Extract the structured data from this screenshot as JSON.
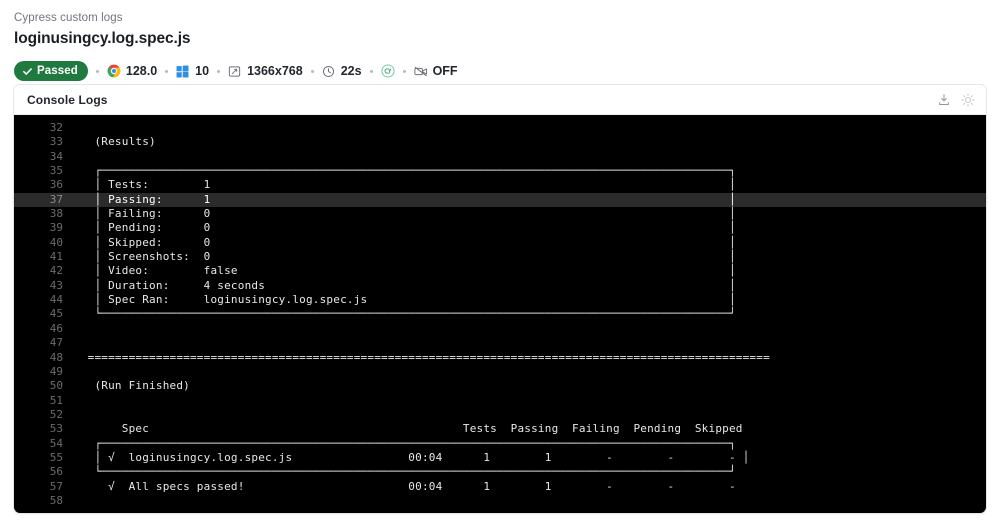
{
  "header": {
    "breadcrumb": "Cypress custom logs",
    "spec_title": "loginusingcy.log.spec.js"
  },
  "status": {
    "badge_label": "Passed",
    "badge_color": "#1f7a3f",
    "items": [
      {
        "icon": "chrome-icon",
        "label": "128.0"
      },
      {
        "icon": "windows-icon",
        "label": "10"
      },
      {
        "icon": "viewport-icon",
        "label": "1366x768"
      },
      {
        "icon": "clock-icon",
        "label": "22s"
      },
      {
        "icon": "cypress-icon",
        "label": ""
      },
      {
        "icon": "video-off-icon",
        "label": "OFF"
      }
    ]
  },
  "console_panel": {
    "title": "Console Logs",
    "actions": [
      {
        "name": "download-icon",
        "tooltip": "Download"
      },
      {
        "name": "theme-toggle-icon",
        "tooltip": "Toggle theme"
      }
    ],
    "highlighted_line": 37,
    "lines": [
      {
        "n": 32,
        "t": ""
      },
      {
        "n": 33,
        "t": "   (Results)"
      },
      {
        "n": 34,
        "t": ""
      },
      {
        "n": 35,
        "t": "   ┌────────────────────────────────────────────────────────────────────────────────────────────┐"
      },
      {
        "n": 36,
        "t": "   │ Tests:        1                                                                            │"
      },
      {
        "n": 37,
        "t": "   │ Passing:      1                                                                            │"
      },
      {
        "n": 38,
        "t": "   │ Failing:      0                                                                            │"
      },
      {
        "n": 39,
        "t": "   │ Pending:      0                                                                            │"
      },
      {
        "n": 40,
        "t": "   │ Skipped:      0                                                                            │"
      },
      {
        "n": 41,
        "t": "   │ Screenshots:  0                                                                            │"
      },
      {
        "n": 42,
        "t": "   │ Video:        false                                                                        │"
      },
      {
        "n": 43,
        "t": "   │ Duration:     4 seconds                                                                    │"
      },
      {
        "n": 44,
        "t": "   │ Spec Ran:     loginusingcy.log.spec.js                                                     │"
      },
      {
        "n": 45,
        "t": "   └────────────────────────────────────────────────────────────────────────────────────────────┘"
      },
      {
        "n": 46,
        "t": ""
      },
      {
        "n": 47,
        "t": ""
      },
      {
        "n": 48,
        "t": "  ===================================================================================================="
      },
      {
        "n": 49,
        "t": ""
      },
      {
        "n": 50,
        "t": "   (Run Finished)"
      },
      {
        "n": 51,
        "t": ""
      },
      {
        "n": 52,
        "t": ""
      },
      {
        "n": 53,
        "t": "       Spec                                              Tests  Passing  Failing  Pending  Skipped"
      },
      {
        "n": 54,
        "t": "   ┌────────────────────────────────────────────────────────────────────────────────────────────┐"
      },
      {
        "n": 55,
        "t": "   │ √  loginusingcy.log.spec.js                 00:04      1        1        -        -        - │"
      },
      {
        "n": 56,
        "t": "   └────────────────────────────────────────────────────────────────────────────────────────────┘"
      },
      {
        "n": 57,
        "t": "     √  All specs passed!                        00:04      1        1        -        -        -"
      },
      {
        "n": 58,
        "t": ""
      }
    ],
    "summary_table": {
      "columns": [
        "Spec",
        "",
        "Tests",
        "Passing",
        "Failing",
        "Pending",
        "Skipped"
      ],
      "rows": [
        [
          "loginusingcy.log.spec.js",
          "00:04",
          "1",
          "1",
          "-",
          "-",
          "-"
        ],
        [
          "All specs passed!",
          "00:04",
          "1",
          "1",
          "-",
          "-",
          "-"
        ]
      ]
    },
    "results_block": {
      "Tests": "1",
      "Passing": "1",
      "Failing": "0",
      "Pending": "0",
      "Skipped": "0",
      "Screenshots": "0",
      "Video": "false",
      "Duration": "4 seconds",
      "Spec Ran": "loginusingcy.log.spec.js"
    }
  }
}
